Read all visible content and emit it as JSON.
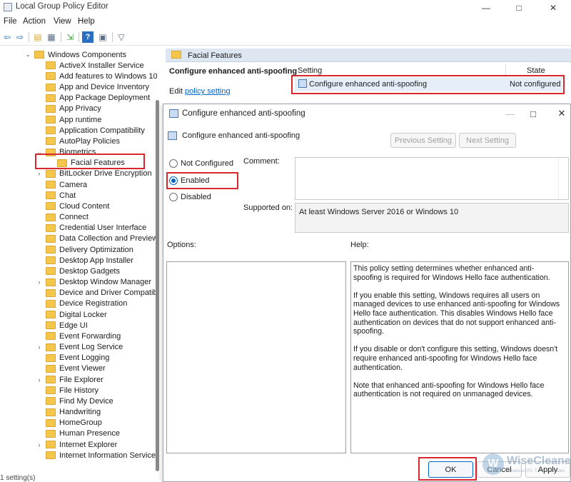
{
  "window": {
    "title": "Local Group Policy Editor"
  },
  "menu": [
    "File",
    "Action",
    "View",
    "Help"
  ],
  "tree": {
    "items": [
      {
        "label": "Windows Components",
        "level": 0,
        "expander": "expanded"
      },
      {
        "label": "ActiveX Installer Service",
        "level": 1,
        "expander": "none"
      },
      {
        "label": "Add features to Windows 10",
        "level": 1,
        "expander": "none"
      },
      {
        "label": "App and Device Inventory",
        "level": 1,
        "expander": "none"
      },
      {
        "label": "App Package Deployment",
        "level": 1,
        "expander": "none"
      },
      {
        "label": "App Privacy",
        "level": 1,
        "expander": "none"
      },
      {
        "label": "App runtime",
        "level": 1,
        "expander": "none"
      },
      {
        "label": "Application Compatibility",
        "level": 1,
        "expander": "none"
      },
      {
        "label": "AutoPlay Policies",
        "level": 1,
        "expander": "none"
      },
      {
        "label": "Biometrics",
        "level": 1,
        "expander": "expanded"
      },
      {
        "label": "Facial Features",
        "level": 2,
        "expander": "none",
        "selected": true
      },
      {
        "label": "BitLocker Drive Encryption",
        "level": 1,
        "expander": "collapsed"
      },
      {
        "label": "Camera",
        "level": 1,
        "expander": "none"
      },
      {
        "label": "Chat",
        "level": 1,
        "expander": "none"
      },
      {
        "label": "Cloud Content",
        "level": 1,
        "expander": "none"
      },
      {
        "label": "Connect",
        "level": 1,
        "expander": "none"
      },
      {
        "label": "Credential User Interface",
        "level": 1,
        "expander": "none"
      },
      {
        "label": "Data Collection and Preview B",
        "level": 1,
        "expander": "none"
      },
      {
        "label": "Delivery Optimization",
        "level": 1,
        "expander": "none"
      },
      {
        "label": "Desktop App Installer",
        "level": 1,
        "expander": "none"
      },
      {
        "label": "Desktop Gadgets",
        "level": 1,
        "expander": "none"
      },
      {
        "label": "Desktop Window Manager",
        "level": 1,
        "expander": "collapsed"
      },
      {
        "label": "Device and Driver Compatibili",
        "level": 1,
        "expander": "none"
      },
      {
        "label": "Device Registration",
        "level": 1,
        "expander": "none"
      },
      {
        "label": "Digital Locker",
        "level": 1,
        "expander": "none"
      },
      {
        "label": "Edge UI",
        "level": 1,
        "expander": "none"
      },
      {
        "label": "Event Forwarding",
        "level": 1,
        "expander": "none"
      },
      {
        "label": "Event Log Service",
        "level": 1,
        "expander": "collapsed"
      },
      {
        "label": "Event Logging",
        "level": 1,
        "expander": "none"
      },
      {
        "label": "Event Viewer",
        "level": 1,
        "expander": "none"
      },
      {
        "label": "File Explorer",
        "level": 1,
        "expander": "collapsed"
      },
      {
        "label": "File History",
        "level": 1,
        "expander": "none"
      },
      {
        "label": "Find My Device",
        "level": 1,
        "expander": "none"
      },
      {
        "label": "Handwriting",
        "level": 1,
        "expander": "none"
      },
      {
        "label": "HomeGroup",
        "level": 1,
        "expander": "none"
      },
      {
        "label": "Human Presence",
        "level": 1,
        "expander": "none"
      },
      {
        "label": "Internet Explorer",
        "level": 1,
        "expander": "collapsed"
      },
      {
        "label": "Internet Information Services",
        "level": 1,
        "expander": "none"
      }
    ]
  },
  "status": {
    "text": "1 setting(s)"
  },
  "right_pane": {
    "header": "Facial Features",
    "policy_title": "Configure enhanced anti-spoofing",
    "edit_prefix": "Edit ",
    "edit_link": "policy setting",
    "columns": {
      "setting": "Setting",
      "state": "State"
    },
    "row": {
      "name": "Configure enhanced anti-spoofing",
      "state": "Not configured"
    }
  },
  "dialog": {
    "title": "Configure enhanced anti-spoofing",
    "subtitle": "Configure enhanced anti-spoofing",
    "prev_label": "Previous Setting",
    "next_label": "Next Setting",
    "radios": {
      "not_configured": "Not Configured",
      "enabled": "Enabled",
      "disabled": "Disabled",
      "selected": "enabled"
    },
    "comment_label": "Comment:",
    "supported_label": "Supported on:",
    "supported_value": "At least Windows Server 2016 or Windows 10",
    "options_label": "Options:",
    "help_label": "Help:",
    "help_paragraphs": [
      "This policy setting determines whether enhanced anti-spoofing is required for Windows Hello face authentication.",
      "If you enable this setting, Windows requires all users on managed devices to use enhanced anti-spoofing for Windows Hello face authentication. This disables Windows Hello face authentication on devices that do not support enhanced anti-spoofing.",
      "If you disable or don't configure this setting, Windows doesn't require enhanced anti-spoofing for Windows Hello face authentication.",
      "Note that enhanced anti-spoofing for Windows Hello face authentication is not required on unmanaged devices."
    ],
    "ok_label": "OK",
    "cancel_label": "Cancel",
    "apply_label": "Apply"
  },
  "watermark": {
    "brand": "WiseCleaner",
    "tagline": "Advanced PC Tune-up Utilities"
  },
  "colors": {
    "highlight": "#d9272e",
    "accent": "#0067c0",
    "folder": "#f4c64b",
    "link": "#0066cc"
  },
  "icons": {
    "app": "policy-editor-icon",
    "toolbar": [
      "back-arrow-icon",
      "forward-arrow-icon",
      "folder-up-icon",
      "show-hide-tree-icon",
      "export-list-icon",
      "help-icon",
      "properties-icon",
      "filter-icon"
    ]
  }
}
